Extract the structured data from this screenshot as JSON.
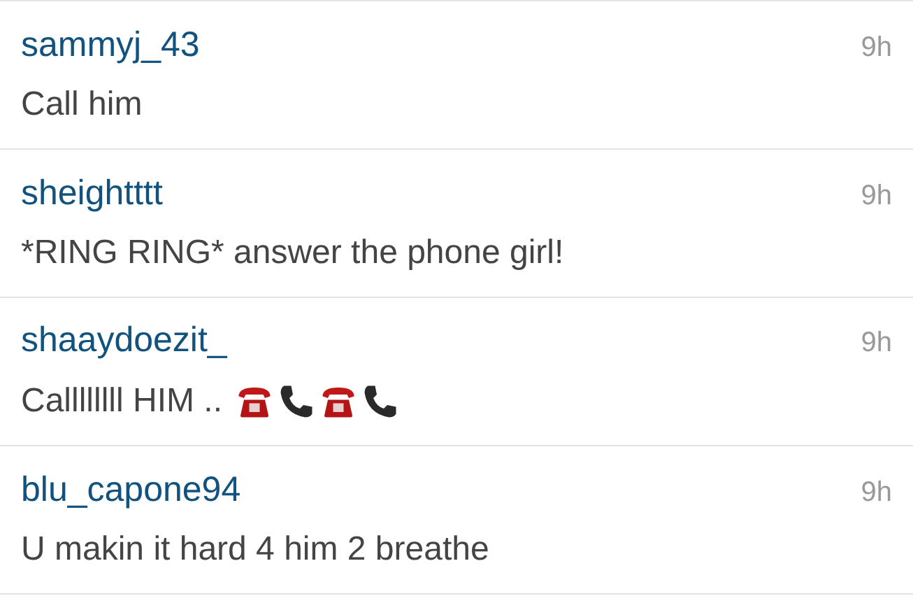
{
  "comments": [
    {
      "username": "sammyj_43",
      "time": "9h",
      "text": "Call him"
    },
    {
      "username": "sheightttt",
      "time": "9h",
      "text": "*RING RING* answer the phone girl!"
    },
    {
      "username": "shaaydoezit_",
      "time": "9h",
      "text": "Callllllll HIM ..",
      "emoji": [
        {
          "kind": "telephone"
        },
        {
          "kind": "receiver"
        },
        {
          "kind": "telephone"
        },
        {
          "kind": "receiver"
        }
      ]
    },
    {
      "username": "blu_capone94",
      "time": "9h",
      "text": "U makin it hard 4 him 2 breathe"
    }
  ]
}
